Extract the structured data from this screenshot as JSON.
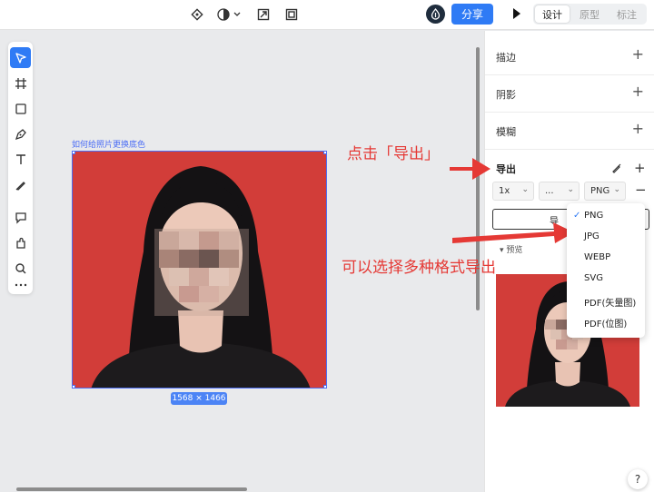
{
  "topbar": {
    "share_label": "分享",
    "tabs": [
      {
        "label": "设计",
        "active": true
      },
      {
        "label": "原型",
        "active": false
      },
      {
        "label": "标注",
        "active": false
      }
    ],
    "icons": [
      "component-icon",
      "theme-toggle-icon",
      "resize-icon",
      "frame-icon",
      "logo-icon",
      "play-icon"
    ]
  },
  "toolbar": {
    "tools": [
      "move-tool-icon",
      "frame-tool-icon",
      "rectangle-tool-icon",
      "pen-tool-icon",
      "text-tool-icon",
      "pencil-tool-icon",
      "comment-tool-icon",
      "plugin-tool-icon",
      "search-tool-icon",
      "more-icon"
    ],
    "active_tool": "move-tool-icon"
  },
  "canvas": {
    "frame_label": "如何给照片更换底色",
    "dimensions": "1568 × 1466",
    "background_color": "#d23d39"
  },
  "annotations": {
    "click_export": "点击「导出」",
    "choose_formats": "可以选择多种格式导出"
  },
  "panel": {
    "sections": [
      {
        "label": "描边"
      },
      {
        "label": "阴影"
      },
      {
        "label": "模糊"
      }
    ],
    "export": {
      "title": "导出",
      "scale": "1x",
      "suffix": "...",
      "format": "PNG",
      "button_label": "导",
      "preview_label": "预览"
    }
  },
  "format_menu": {
    "selected": "PNG",
    "options": [
      "PNG",
      "JPG",
      "WEBP",
      "SVG",
      "PDF(矢量图)",
      "PDF(位图)"
    ]
  },
  "help_label": "?",
  "colors": {
    "accent": "#2f7bf5",
    "selection": "#4c6ef5",
    "photo_bg": "#d23d39",
    "annotation": "#e53935"
  }
}
